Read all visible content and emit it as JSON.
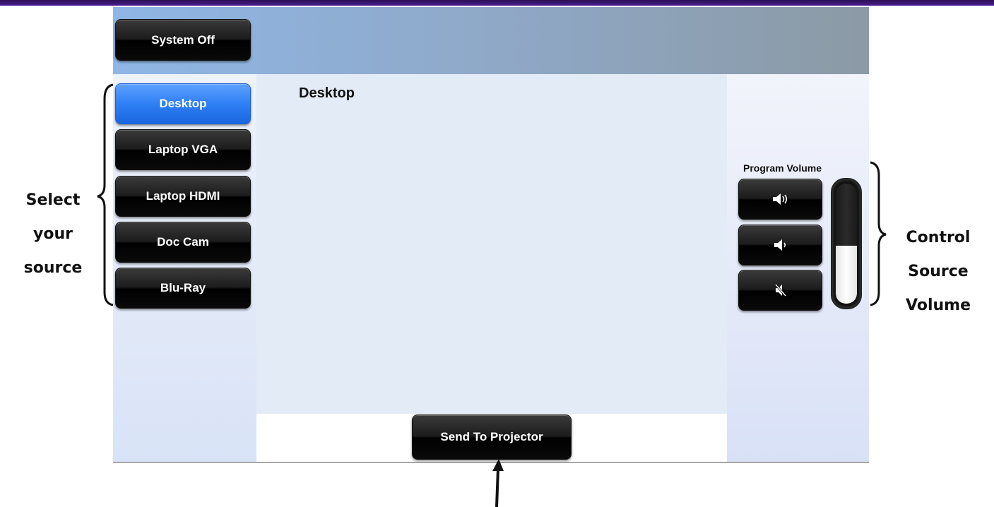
{
  "header": {
    "system_off_label": "System Off"
  },
  "sources": [
    {
      "label": "Desktop",
      "active": true
    },
    {
      "label": "Laptop VGA",
      "active": false
    },
    {
      "label": "Laptop HDMI",
      "active": false
    },
    {
      "label": "Doc Cam",
      "active": false
    },
    {
      "label": "Blu-Ray",
      "active": false
    }
  ],
  "content": {
    "title": "Desktop",
    "send_label": "Send To Projector"
  },
  "volume": {
    "label": "Program Volume",
    "buttons": [
      "volume-up-icon",
      "volume-down-icon",
      "mute-icon"
    ],
    "level_fraction": 0.48
  },
  "annotations": {
    "left": [
      "Select",
      "your",
      "source"
    ],
    "right": [
      "Control",
      "Source",
      "Volume"
    ]
  },
  "colors": {
    "active_button": "#2f7ff5",
    "button": "#000000",
    "header_bar": "#4b1f8f"
  }
}
